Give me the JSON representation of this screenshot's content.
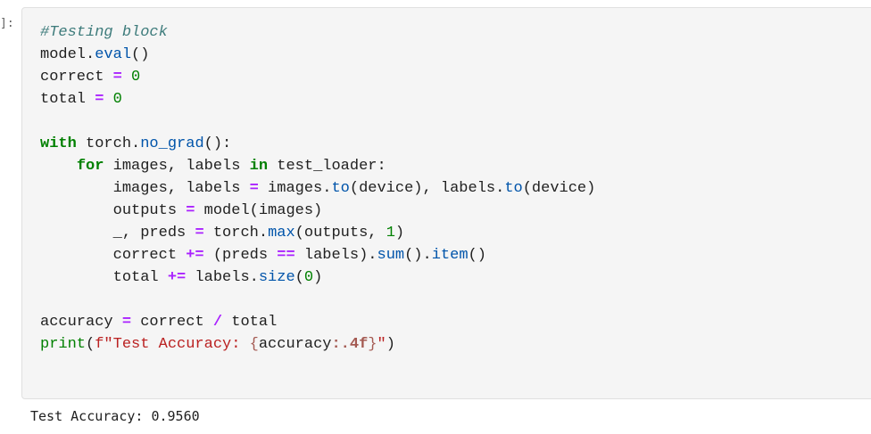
{
  "cell": {
    "prompt": "]:",
    "lines": [
      [
        {
          "t": "#Testing block",
          "c": "comment"
        }
      ],
      [
        {
          "t": "model."
        },
        {
          "t": "eval",
          "c": "call"
        },
        {
          "t": "()"
        }
      ],
      [
        {
          "t": "correct "
        },
        {
          "t": "=",
          "c": "op"
        },
        {
          "t": " "
        },
        {
          "t": "0",
          "c": "num"
        }
      ],
      [
        {
          "t": "total "
        },
        {
          "t": "=",
          "c": "op"
        },
        {
          "t": " "
        },
        {
          "t": "0",
          "c": "num"
        }
      ],
      [],
      [
        {
          "t": "with",
          "c": "kw"
        },
        {
          "t": " torch."
        },
        {
          "t": "no_grad",
          "c": "call"
        },
        {
          "t": "():"
        }
      ],
      [
        {
          "t": "    "
        },
        {
          "t": "for",
          "c": "kw"
        },
        {
          "t": " images, labels "
        },
        {
          "t": "in",
          "c": "kw"
        },
        {
          "t": " test_loader:"
        }
      ],
      [
        {
          "t": "        images, labels "
        },
        {
          "t": "=",
          "c": "op"
        },
        {
          "t": " images."
        },
        {
          "t": "to",
          "c": "call"
        },
        {
          "t": "(device), labels."
        },
        {
          "t": "to",
          "c": "call"
        },
        {
          "t": "(device)"
        }
      ],
      [
        {
          "t": "        outputs "
        },
        {
          "t": "=",
          "c": "op"
        },
        {
          "t": " model(images)"
        }
      ],
      [
        {
          "t": "        _, preds "
        },
        {
          "t": "=",
          "c": "op"
        },
        {
          "t": " torch."
        },
        {
          "t": "max",
          "c": "call"
        },
        {
          "t": "(outputs, "
        },
        {
          "t": "1",
          "c": "num"
        },
        {
          "t": ")"
        }
      ],
      [
        {
          "t": "        correct "
        },
        {
          "t": "+=",
          "c": "op"
        },
        {
          "t": " (preds "
        },
        {
          "t": "==",
          "c": "op"
        },
        {
          "t": " labels)."
        },
        {
          "t": "sum",
          "c": "call"
        },
        {
          "t": "()."
        },
        {
          "t": "item",
          "c": "call"
        },
        {
          "t": "()"
        }
      ],
      [
        {
          "t": "        total "
        },
        {
          "t": "+=",
          "c": "op"
        },
        {
          "t": " labels."
        },
        {
          "t": "size",
          "c": "call"
        },
        {
          "t": "("
        },
        {
          "t": "0",
          "c": "num"
        },
        {
          "t": ")"
        }
      ],
      [],
      [
        {
          "t": "accuracy "
        },
        {
          "t": "=",
          "c": "op"
        },
        {
          "t": " correct "
        },
        {
          "t": "/",
          "c": "op"
        },
        {
          "t": " total"
        }
      ],
      [
        {
          "t": "print",
          "c": "builtin"
        },
        {
          "t": "("
        },
        {
          "t": "f\"Test Accuracy: ",
          "c": "str"
        },
        {
          "t": "{",
          "c": "interp"
        },
        {
          "t": "accuracy"
        },
        {
          "t": ":.4f",
          "c": "fmt"
        },
        {
          "t": "}",
          "c": "interp"
        },
        {
          "t": "\"",
          "c": "str"
        },
        {
          "t": ")"
        }
      ]
    ]
  },
  "output": {
    "text": "Test Accuracy: 0.9560"
  }
}
